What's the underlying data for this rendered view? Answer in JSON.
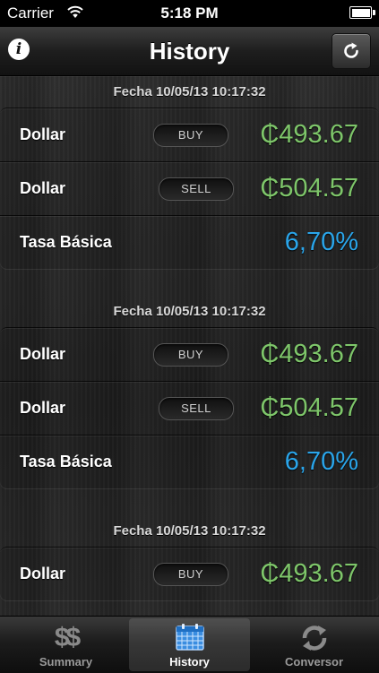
{
  "status_bar": {
    "carrier": "Carrier",
    "time": "5:18 PM"
  },
  "nav": {
    "title": "History",
    "info_icon": "info-icon",
    "refresh_icon": "refresh-icon"
  },
  "colors": {
    "buy_sell_value": "#7ec66a",
    "rate_value": "#2aa5ea"
  },
  "groups": [
    {
      "header": "Fecha 10/05/13 10:17:32",
      "rows": [
        {
          "label": "Dollar",
          "badge": "BUY",
          "value": "₵493.67"
        },
        {
          "label": "Dollar",
          "badge": "SELL",
          "value": "₵504.57"
        },
        {
          "label": "Tasa Básica",
          "value": "6,70%"
        }
      ]
    },
    {
      "header": "Fecha 10/05/13 10:17:32",
      "rows": [
        {
          "label": "Dollar",
          "badge": "BUY",
          "value": "₵493.67"
        },
        {
          "label": "Dollar",
          "badge": "SELL",
          "value": "₵504.57"
        },
        {
          "label": "Tasa Básica",
          "value": "6,70%"
        }
      ]
    },
    {
      "header": "Fecha 10/05/13 10:17:32",
      "rows": [
        {
          "label": "Dollar",
          "badge": "BUY",
          "value": "₵493.67"
        }
      ]
    }
  ],
  "tabbar": {
    "tabs": [
      {
        "label": "Summary",
        "icon": "dollar-sign-icon",
        "active": false
      },
      {
        "label": "History",
        "icon": "calendar-icon",
        "active": true
      },
      {
        "label": "Conversor",
        "icon": "sync-arrows-icon",
        "active": false
      }
    ]
  }
}
